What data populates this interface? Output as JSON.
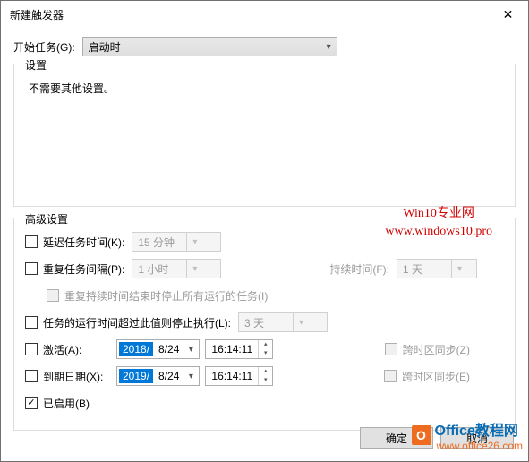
{
  "window": {
    "title": "新建触发器",
    "close": "✕"
  },
  "begin": {
    "label": "开始任务(G):",
    "value": "启动时"
  },
  "settings": {
    "legend": "设置",
    "message": "不需要其他设置。"
  },
  "watermark1": {
    "line1": "Win10专业网",
    "line2": "www.windows10.pro"
  },
  "watermark2": {
    "badge": "O",
    "text1": "Office教程网",
    "text2": "www.office26.com"
  },
  "advanced": {
    "legend": "高级设置",
    "delay": {
      "label": "延迟任务时间(K):",
      "value": "15 分钟"
    },
    "repeat": {
      "label": "重复任务间隔(P):",
      "value": "1 小时"
    },
    "duration": {
      "label": "持续时间(F):",
      "value": "1 天"
    },
    "stopAtEnd": {
      "label": "重复持续时间结束时停止所有运行的任务(I)"
    },
    "stopLonger": {
      "label": "任务的运行时间超过此值则停止执行(L):",
      "value": "3 天"
    },
    "activate": {
      "label": "激活(A):",
      "date_y": "2018/",
      "date_md": " 8/24",
      "time": "16:14:11"
    },
    "expire": {
      "label": "到期日期(X):",
      "date_y": "2019/",
      "date_md": " 8/24",
      "time": "16:14:11"
    },
    "tzSync1": {
      "label": "跨时区同步(Z)"
    },
    "tzSync2": {
      "label": "跨时区同步(E)"
    },
    "enabled": {
      "label": "已启用(B)"
    }
  },
  "buttons": {
    "ok": "确定",
    "cancel": "取消"
  }
}
